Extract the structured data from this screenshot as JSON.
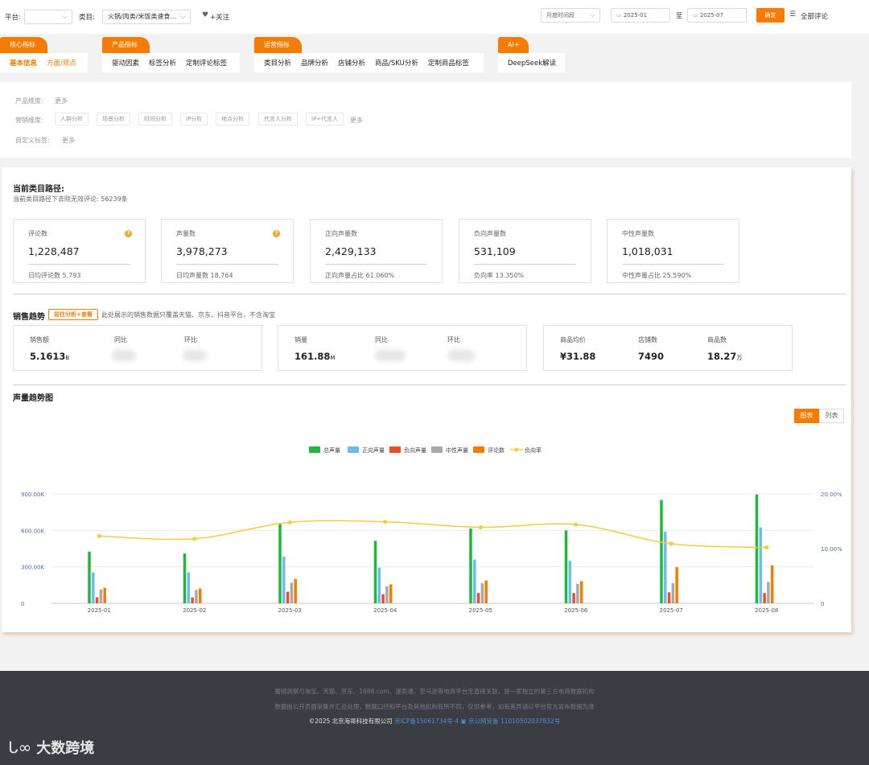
{
  "filters": {
    "platform_label": "平台:",
    "category_label": "类目:",
    "category_value": "火锅/肉类/米饭类速食...",
    "follow_label": "+关注",
    "period_value": "月度时间段",
    "start_date": "2025-01",
    "to_label": "至",
    "end_date": "2025-07",
    "confirm_label": "确定",
    "all_reviews_label": "全部评论"
  },
  "tab_groups": [
    {
      "title": "核心指标",
      "items": [
        "基本信息",
        "方面/观点"
      ]
    },
    {
      "title": "产品指标",
      "items": [
        "驱动因素",
        "标签分析",
        "定制评论标签"
      ]
    },
    {
      "title": "运营指标",
      "items": [
        "类目分析",
        "品牌分析",
        "店铺分析",
        "商品/SKU分析",
        "定制商品标签"
      ]
    },
    {
      "title": "AI+",
      "items": [
        "DeepSeek解读"
      ]
    }
  ],
  "dimensions": {
    "product_label": "产品维度:",
    "product_more": "更多",
    "marketing_label": "营销维度:",
    "marketing_chips": [
      "人群分析",
      "场景分析",
      "时间分析",
      "IP分析",
      "地点分析",
      "代言人分析",
      "IP+代言人"
    ],
    "marketing_more": "更多",
    "custom_label": "自定义标签:",
    "custom_more": "更多"
  },
  "path": {
    "title": "当前类目路径:",
    "subtitle": "当前类目路径下去除无效评论: 56239条"
  },
  "metrics": [
    {
      "label": "评论数",
      "value": "1,228,487",
      "foot": "日均评论数  5,793",
      "help": "?"
    },
    {
      "label": "声量数",
      "value": "3,978,273",
      "foot": "日均声量数  18,764",
      "help": "?"
    },
    {
      "label": "正向声量数",
      "value": "2,429,133",
      "foot": "正向声量占比  61.060%"
    },
    {
      "label": "负向声量数",
      "value": "531,109",
      "foot": "负向率  13.350%"
    },
    {
      "label": "中性声量数",
      "value": "1,018,031",
      "foot": "中性声量占比  25.590%"
    }
  ],
  "sales": {
    "title": "销售趋势",
    "link": "前往分析+查看",
    "note": "此处展示的销售数据只覆盖天猫、京东、抖音平台，不含淘宝",
    "card1": {
      "amount_label": "销售额",
      "amount_value": "5.1613",
      "amount_unit": "B",
      "yoy_label": "同比",
      "mom_label": "环比"
    },
    "card2": {
      "qty_label": "销量",
      "qty_value": "161.88",
      "qty_unit": "M",
      "yoy_label": "同比",
      "mom_label": "环比"
    },
    "card3": {
      "price_label": "商品均价",
      "price_value": "¥31.88",
      "shops_label": "店铺数",
      "shops_value": "7490",
      "goods_label": "商品数",
      "goods_value": "18.27",
      "goods_unit": "万"
    }
  },
  "trend": {
    "title": "声量趋势图",
    "toggle_chart": "图表",
    "toggle_list": "列表"
  },
  "chart_data": {
    "type": "bar",
    "categories": [
      "2025-01",
      "2025-02",
      "2025-03",
      "2025-04",
      "2025-05",
      "2025-06",
      "2025-07",
      "2025-08"
    ],
    "series": [
      {
        "name": "总声量",
        "color": "#1fb83a",
        "values": [
          425000,
          410000,
          655000,
          515000,
          615000,
          600000,
          850000,
          895000
        ]
      },
      {
        "name": "正向声量",
        "color": "#6cbcf0",
        "values": [
          255000,
          255000,
          385000,
          295000,
          360000,
          350000,
          590000,
          625000
        ]
      },
      {
        "name": "负向声量",
        "color": "#e8502a",
        "values": [
          50000,
          48000,
          95000,
          75000,
          85000,
          85000,
          90000,
          85000
        ]
      },
      {
        "name": "中性声量",
        "color": "#a8a8a8",
        "values": [
          115000,
          110000,
          170000,
          140000,
          165000,
          160000,
          165000,
          175000
        ]
      },
      {
        "name": "评论数",
        "color": "#f57c00",
        "values": [
          128000,
          122000,
          200000,
          155000,
          188000,
          182000,
          298000,
          312000
        ]
      }
    ],
    "line": {
      "name": "负向率",
      "color": "#f5cc3a",
      "values": [
        12.3,
        11.8,
        14.8,
        14.9,
        13.9,
        14.4,
        10.9,
        10.2
      ]
    },
    "y_left": {
      "ticks": [
        "0",
        "300.00K",
        "600.00K",
        "900.00K"
      ],
      "max": 900000
    },
    "y_right": {
      "ticks": [
        "0",
        "10.00%",
        "20.00%"
      ],
      "max": 20
    },
    "legend_position": "top-center"
  },
  "footer": {
    "line1": "魔镜洞察与淘宝、天猫、京东、1688.com、速卖通、亚马逊等电商平台无直接关联，是一家独立的第三方电商数据机构",
    "line2": "数据由公开页面采集并汇总处理，数据口径和平台及其他机构有所不同，仅供参考，如有差异请以平台官方发布数据为准",
    "copy": "©2025 北京海哥科技有限公司",
    "icp": "京ICP备15061734号-4",
    "police": "京公网安备 11010502037832号",
    "brand": "大数跨境"
  }
}
